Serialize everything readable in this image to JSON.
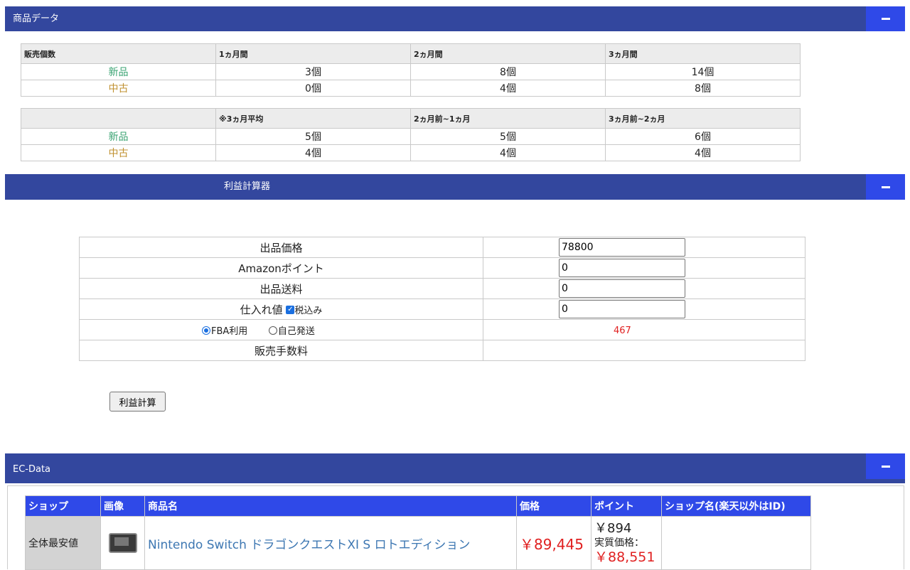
{
  "sections": {
    "product_data": "商品データ",
    "profit_calc": "利益計算器",
    "ec_data": "EC-Data"
  },
  "sales_table_1": {
    "headers": [
      "販売個数",
      "1ヵ月間",
      "2ヵ月間",
      "3ヵ月間"
    ],
    "rows": [
      [
        "新品",
        "3個",
        "8個",
        "14個"
      ],
      [
        "中古",
        "0個",
        "4個",
        "8個"
      ]
    ]
  },
  "sales_table_2": {
    "headers": [
      "",
      "※3ヵ月平均",
      "2ヵ月前~1ヵ月",
      "3ヵ月前~2ヵ月"
    ],
    "rows": [
      [
        "新品",
        "5個",
        "5個",
        "6個"
      ],
      [
        "中古",
        "4個",
        "4個",
        "4個"
      ]
    ]
  },
  "calculator": {
    "listing_price_label": "出品価格",
    "listing_price_value": "78800",
    "amazon_point_label": "Amazonポイント",
    "amazon_point_value": "0",
    "shipping_label": "出品送料",
    "shipping_value": "0",
    "cost_label": "仕入れ値",
    "tax_checkbox_label": "税込み",
    "tax_checked": true,
    "cost_value": "0",
    "fba_label": "FBA利用",
    "self_ship_label": "自己発送",
    "fba_fee": "467",
    "sales_fee_label": "販売手数料",
    "button_label": "利益計算"
  },
  "ec_table": {
    "headers": [
      "ショップ",
      "画像",
      "商品名",
      "価格",
      "ポイント",
      "ショップ名(楽天以外はID)"
    ],
    "row": {
      "shop": "全体最安値",
      "image_icon": "product-thumbnail",
      "product_name": "Nintendo Switch ドラゴンクエストXI S ロトエディション",
      "price": "￥89,445",
      "point": "￥894",
      "real_price_label": "実質価格：",
      "real_price": "￥88,551",
      "shop_name": ""
    }
  },
  "colors": {
    "header_bar": "#33479e",
    "toggle_button": "#2f49e8",
    "new_item": "#3aa372",
    "used_item": "#c09130",
    "price_red": "#e02020",
    "link_blue": "#3d77b2"
  }
}
